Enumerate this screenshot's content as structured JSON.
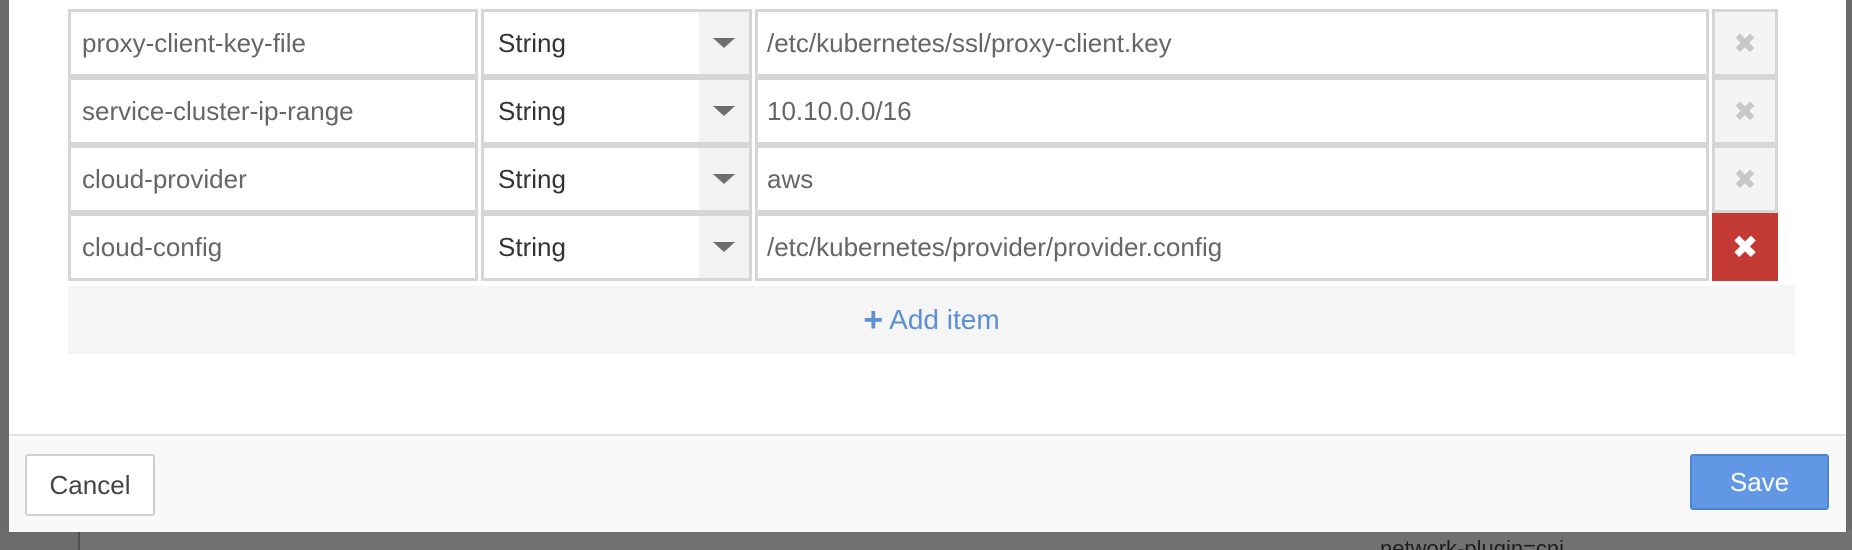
{
  "rows": [
    {
      "key": "proxy-client-key-file",
      "type": "String",
      "value": "/etc/kubernetes/ssl/proxy-client.key",
      "remove_active": false
    },
    {
      "key": "service-cluster-ip-range",
      "type": "String",
      "value": "10.10.0.0/16",
      "remove_active": false
    },
    {
      "key": "cloud-provider",
      "type": "String",
      "value": "aws",
      "remove_active": false
    },
    {
      "key": "cloud-config",
      "type": "String",
      "value": "/etc/kubernetes/provider/provider.config",
      "remove_active": true
    }
  ],
  "add_item": {
    "icon": "+",
    "label": "Add item"
  },
  "remove_glyph": "✖",
  "footer": {
    "cancel_label": "Cancel",
    "save_label": "Save"
  },
  "background": {
    "partial_text": "network-plugin=cni"
  },
  "colors": {
    "accent": "#6297e6",
    "link": "#5b8fd6",
    "danger": "#c23a33"
  }
}
